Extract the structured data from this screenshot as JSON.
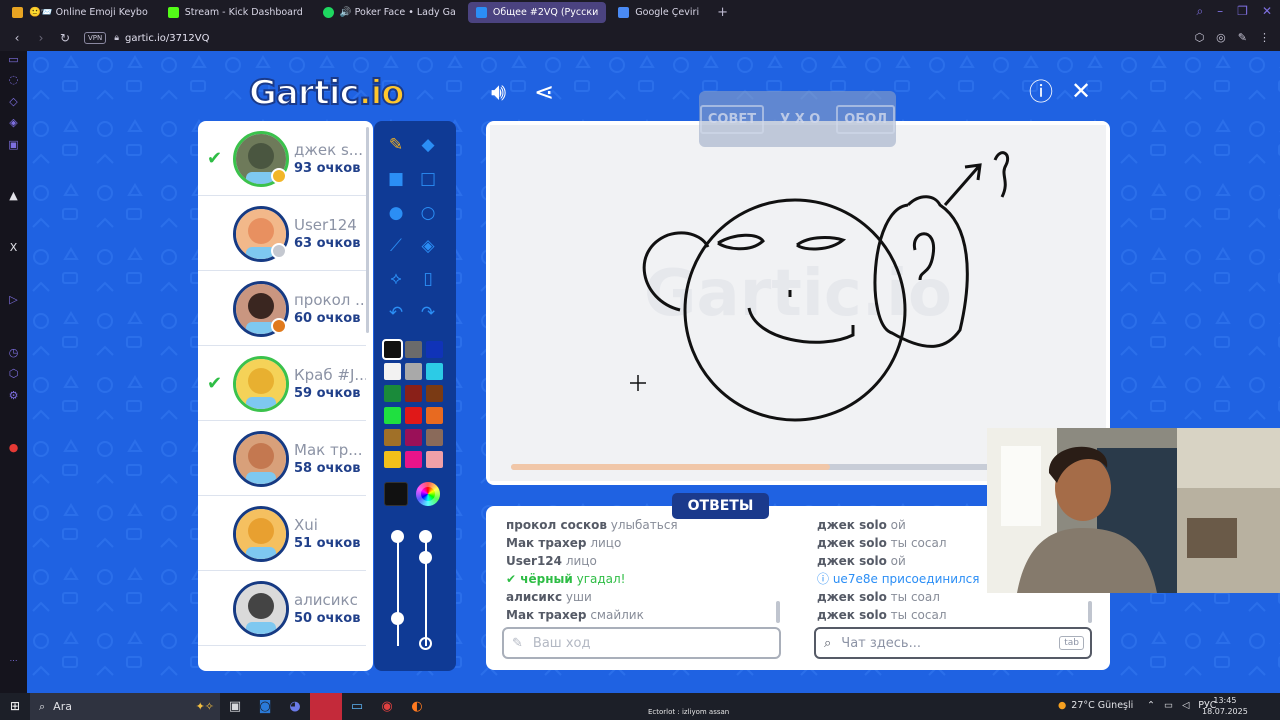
{
  "browser": {
    "tabs": [
      {
        "label": "🙂📨 Online Emoji Keybo",
        "icon": "emoji-site-icon"
      },
      {
        "label": "Stream - Kick Dashboard",
        "icon": "kick-icon"
      },
      {
        "label": "🔊 Poker Face • Lady Ga",
        "icon": "spotify-icon"
      },
      {
        "label": "Общее #2VQ (Русски",
        "icon": "gartic-icon",
        "active": true
      },
      {
        "label": "Google Çeviri",
        "icon": "translate-icon"
      }
    ],
    "vpn_label": "VPN",
    "url": "gartic.io/3712VQ"
  },
  "game": {
    "logo_text": "Gartic",
    "logo_suffix": ".io",
    "hint_boxes": [
      "СОВЕТ",
      "У Х О",
      "ОБОЛ"
    ],
    "answers_label": "ОТВЕТЫ",
    "timer_progress": 0.57
  },
  "players": [
    {
      "name": "джек s...",
      "score": "93 очков",
      "guessed": true,
      "badge_color": "#f2b628"
    },
    {
      "name": "User124",
      "score": "63 очков",
      "guessed": false,
      "badge_color": "#c4c8d0"
    },
    {
      "name": "прокол ...",
      "score": "60 очков",
      "guessed": false,
      "badge_color": "#e07a1d"
    },
    {
      "name": "Краб #J...",
      "score": "59 очков",
      "guessed": true,
      "badge_color": ""
    },
    {
      "name": "Мак тр...",
      "score": "58 очков",
      "guessed": false,
      "badge_color": ""
    },
    {
      "name": "Xui",
      "score": "51 очков",
      "guessed": false,
      "badge_color": ""
    },
    {
      "name": "алисикс",
      "score": "50 очков",
      "guessed": false,
      "badge_color": ""
    }
  ],
  "palette": [
    "#111111",
    "#6b6b6b",
    "#1033b8",
    "#f2f2f2",
    "#a9a9a9",
    "#2ccbe6",
    "#1a8a3a",
    "#8a2018",
    "#7a3a14",
    "#1fe040",
    "#e01818",
    "#e86a20",
    "#a07028",
    "#9a1058",
    "#8a6a5a",
    "#f2c01a",
    "#e8148a",
    "#f0a0a8"
  ],
  "answers_chat": [
    {
      "name": "прокол сосков",
      "text": "улыбаться"
    },
    {
      "name": "Мак трахер",
      "text": "лицо"
    },
    {
      "name": "User124",
      "text": "лицо"
    },
    {
      "name": "чёрный",
      "text": "угадал!",
      "kind": "correct"
    },
    {
      "name": "алисикс",
      "text": "уши"
    },
    {
      "name": "Мак трахер",
      "text": "смайлик"
    }
  ],
  "general_chat": [
    {
      "name": "джек solo",
      "text": "ой"
    },
    {
      "name": "джек solo",
      "text": "ты сосал"
    },
    {
      "name": "джек solo",
      "text": "ой"
    },
    {
      "name": "ue7e8e",
      "text": "присоединился",
      "kind": "join"
    },
    {
      "name": "джек solo",
      "text": "ты соал"
    },
    {
      "name": "джек solo",
      "text": "ты сосал"
    }
  ],
  "inputs": {
    "guess_placeholder": "Ваш ход",
    "chat_placeholder": "Чат здесь...",
    "tab_key": "tab"
  },
  "taskbar": {
    "search_placeholder": "Ara",
    "ticker": "Ectorlot : izliyom assan",
    "weather": "27°C Güneşli",
    "language": "РУС",
    "time": "13:45",
    "date": "18.07.2025"
  }
}
